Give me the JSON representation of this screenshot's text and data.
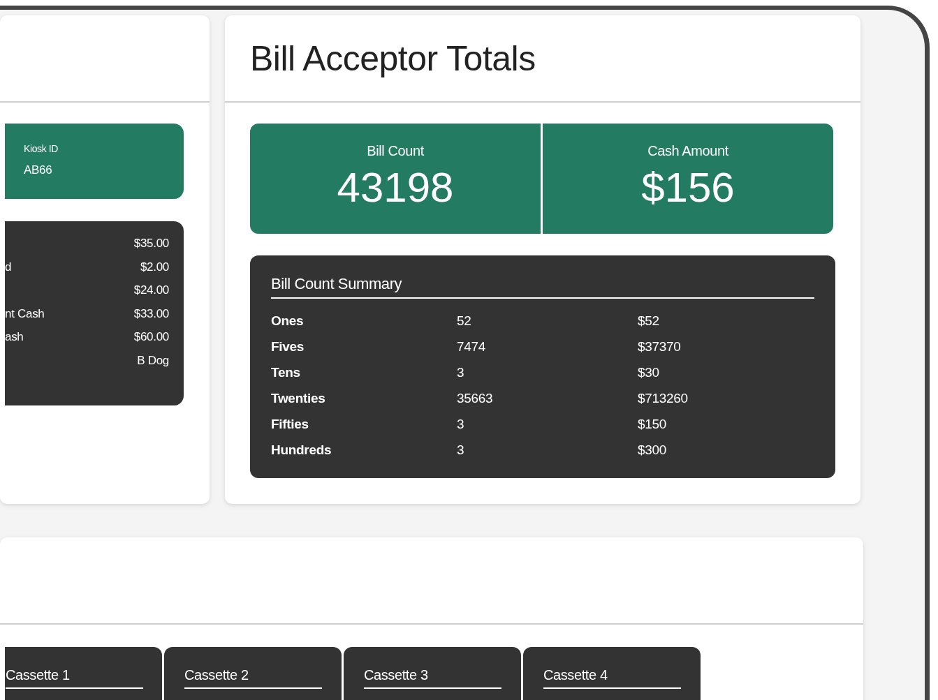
{
  "left_panel": {
    "kiosk": {
      "label": "Kiosk ID",
      "value": "AB66"
    },
    "rows": [
      {
        "value": "$35.00"
      },
      {
        "label": "d",
        "value": "$2.00"
      },
      {
        "value": "$24.00"
      },
      {
        "label": "nt Cash",
        "value": "$33.00"
      },
      {
        "label": "ash",
        "value": "$60.00"
      },
      {
        "value": "B Dog"
      }
    ]
  },
  "bill_acceptor": {
    "title": "Bill Acceptor Totals",
    "stats": [
      {
        "label": "Bill Count",
        "value": "43198"
      },
      {
        "label": "Cash Amount",
        "value": "$156"
      }
    ],
    "summary": {
      "title": "Bill Count Summary",
      "rows": [
        {
          "denomination": "Ones",
          "count": "52",
          "amount": "$52"
        },
        {
          "denomination": "Fives",
          "count": "7474",
          "amount": "$37370"
        },
        {
          "denomination": "Tens",
          "count": "3",
          "amount": "$30"
        },
        {
          "denomination": "Twenties",
          "count": "35663",
          "amount": "$713260"
        },
        {
          "denomination": "Fifties",
          "count": "3",
          "amount": "$150"
        },
        {
          "denomination": "Hundreds",
          "count": "3",
          "amount": "$300"
        }
      ]
    }
  },
  "cassettes": [
    {
      "label": "Cassette 1"
    },
    {
      "label": "Cassette 2"
    },
    {
      "label": "Cassette 3"
    },
    {
      "label": "Cassette 4"
    }
  ]
}
